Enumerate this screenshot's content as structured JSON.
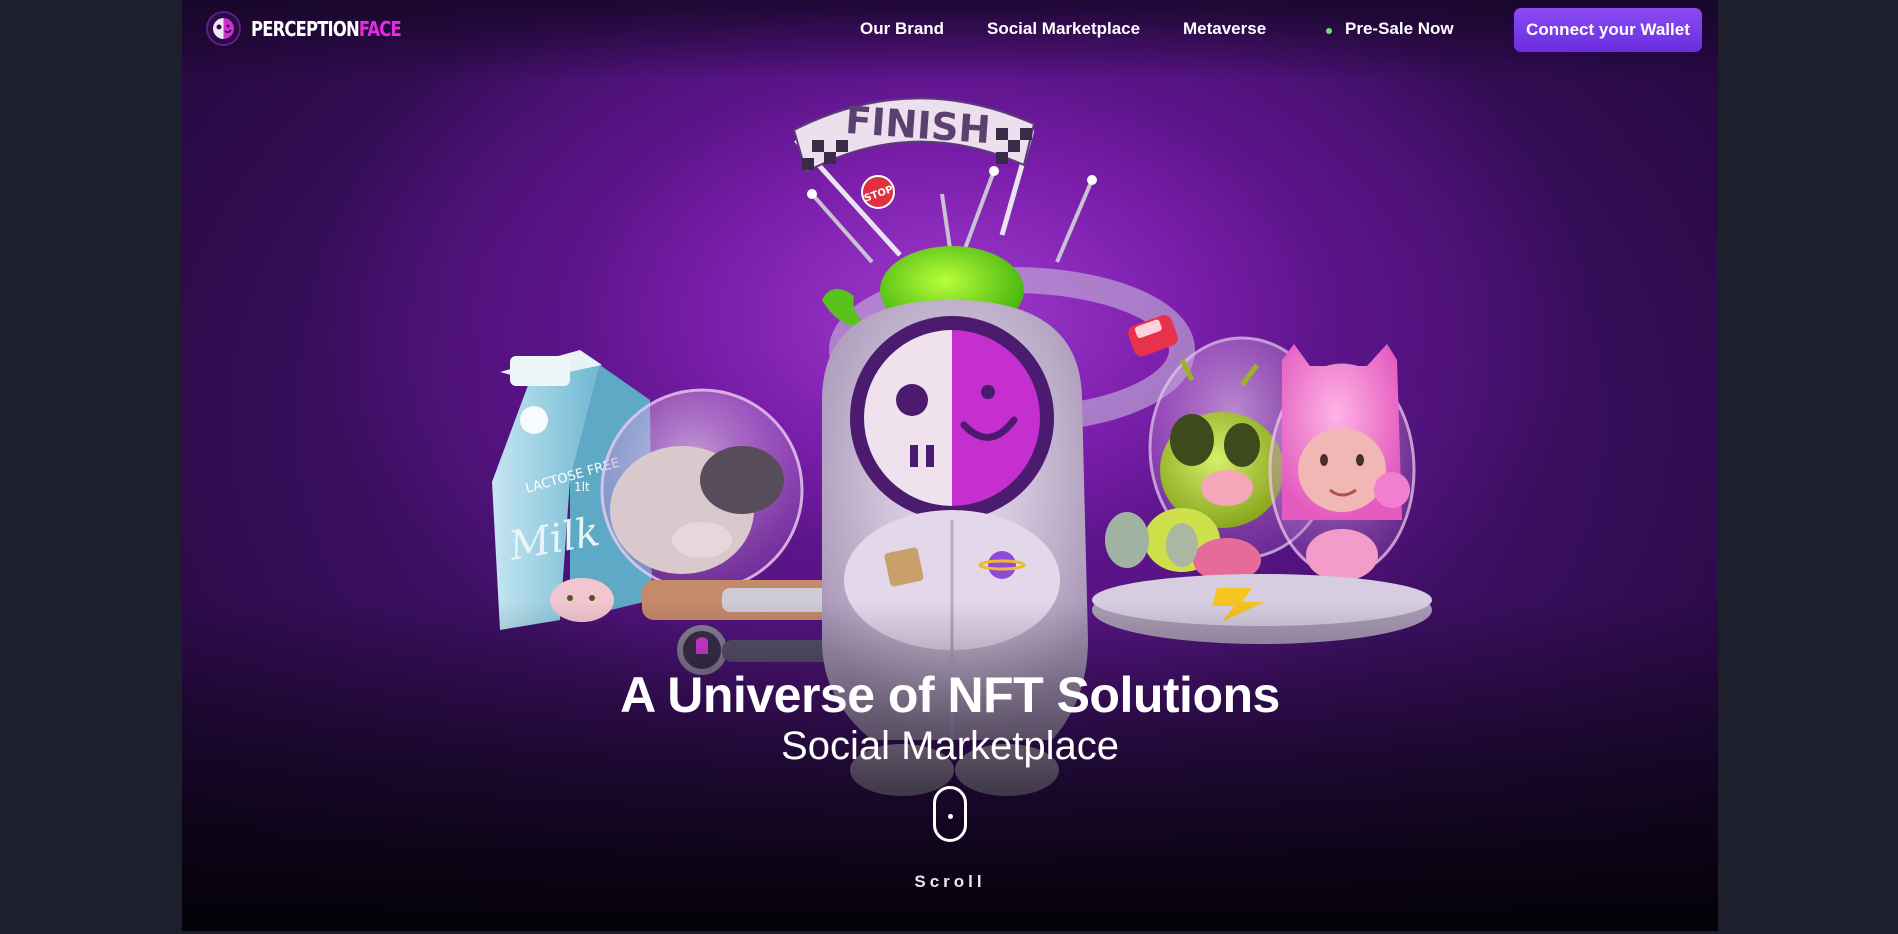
{
  "logo": {
    "text_white": "PERCEPTION",
    "text_accent": "FACE",
    "accent_color": "#e62be0",
    "icon": "skull-smiley-face-icon"
  },
  "nav": {
    "links": [
      {
        "label": "Our Brand"
      },
      {
        "label": "Social Marketplace"
      },
      {
        "label": "Metaverse"
      },
      {
        "label": "Pre-Sale Now"
      }
    ],
    "status_dot_color": "#6ee36a",
    "wallet_button": "Connect your Wallet",
    "wallet_color": "#7a3cec"
  },
  "hero": {
    "banner_text": "FINISH",
    "sign_text": "STOP",
    "carton_text_top": "LACTOSE FREE",
    "carton_volume": "1lt",
    "carton_brand": "Milk",
    "title": "A Universe of NFT Solutions",
    "subtitle": "Social Marketplace",
    "scroll_label": "Scroll",
    "scroll_icon": "mouse-scroll-icon"
  }
}
